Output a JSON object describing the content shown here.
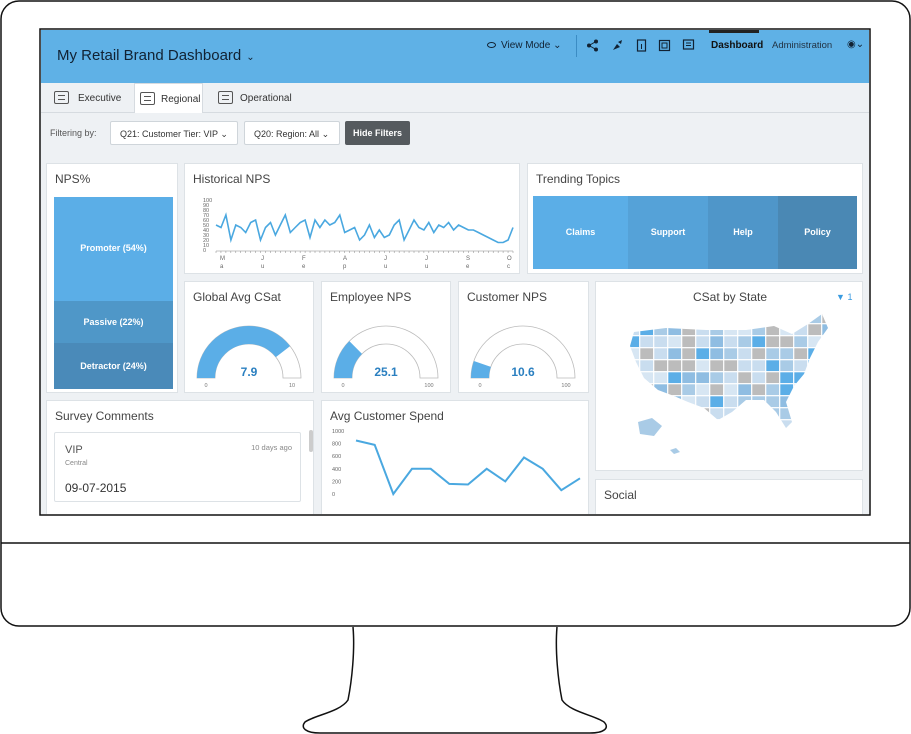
{
  "header": {
    "title": "My Retail Brand Dashboard",
    "view_mode": "View Mode",
    "nav_dashboard": "Dashboard",
    "nav_admin": "Administration"
  },
  "tabs": [
    "Executive",
    "Regional",
    "Operational"
  ],
  "filters": {
    "label": "Filtering by:",
    "chip1": "Q21: Customer Tier: VIP",
    "chip2": "Q20: Region: All",
    "hide_button": "Hide Filters"
  },
  "nps_pct": {
    "title": "NPS%",
    "promoter": "Promoter (54%)",
    "passive": "Passive (22%)",
    "detractor": "Detractor (24%)"
  },
  "historical_nps": {
    "title": "Historical NPS",
    "y_ticks": [
      "100",
      "90",
      "80",
      "70",
      "60",
      "50",
      "40",
      "30",
      "20",
      "10",
      "0"
    ],
    "x_ticks": [
      [
        "M",
        "a"
      ],
      [
        "J",
        "u"
      ],
      [
        "F",
        "e"
      ],
      [
        "A",
        "p"
      ],
      [
        "J",
        "u"
      ],
      [
        "J",
        "u"
      ],
      [
        "S",
        "e"
      ],
      [
        "O",
        "c"
      ]
    ],
    "values": [
      50,
      45,
      70,
      20,
      50,
      45,
      35,
      55,
      60,
      20,
      45,
      55,
      30,
      50,
      70,
      35,
      45,
      55,
      60,
      25,
      60,
      45,
      60,
      50,
      55,
      70,
      35,
      40,
      45,
      20,
      30,
      50,
      25,
      40,
      25,
      30,
      50,
      60,
      20,
      40,
      60,
      45,
      40,
      55,
      35,
      50,
      45,
      55,
      40,
      50,
      45,
      40,
      40,
      35,
      30,
      25,
      20,
      15,
      15,
      20,
      45
    ]
  },
  "trending_topics": {
    "title": "Trending Topics",
    "topics": [
      "Claims",
      "Support",
      "Help",
      "Policy"
    ]
  },
  "gauges": [
    {
      "title": "Global Avg CSat",
      "value": "7.9",
      "min": "0",
      "max": "10",
      "fraction": 0.79
    },
    {
      "title": "Employee NPS",
      "value": "25.1",
      "min": "0",
      "max": "100",
      "fraction": 0.251
    },
    {
      "title": "Customer NPS",
      "value": "10.6",
      "min": "0",
      "max": "100",
      "fraction": 0.106
    }
  ],
  "csat_by_state": {
    "title": "CSat by State",
    "filter_count": "1"
  },
  "survey_comments": {
    "title": "Survey Comments",
    "tier": "VIP",
    "region": "Central",
    "age": "10 days ago",
    "date": "09-07-2015"
  },
  "avg_spend": {
    "title": "Avg Customer Spend",
    "y_ticks": [
      "1000",
      "800",
      "600",
      "400",
      "200",
      "0"
    ],
    "values": [
      850,
      780,
      0,
      400,
      400,
      160,
      150,
      400,
      200,
      580,
      400,
      60,
      250
    ]
  },
  "social": {
    "title": "Social"
  },
  "colors": {
    "header": "#5fb1e6",
    "accent": "#4aa8e0",
    "promoter": "#5baee7",
    "passive": "#4f97c8",
    "detractor": "#4a8ab9"
  }
}
